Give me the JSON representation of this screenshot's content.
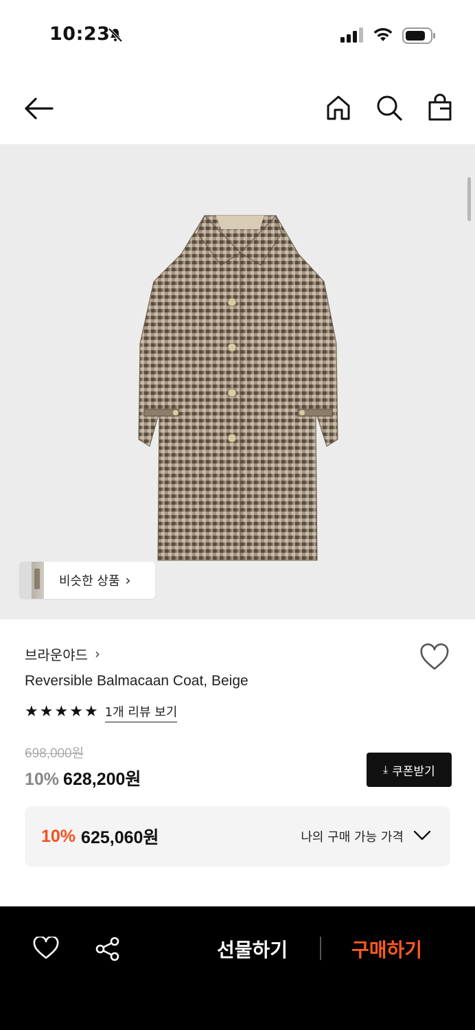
{
  "status": {
    "time": "10:23"
  },
  "nav": {},
  "gallery": {
    "similar_label": "비슷한 상품"
  },
  "product": {
    "brand": "브라운야드",
    "name": "Reversible Balmacaan Coat, Beige",
    "rating_stars": 5,
    "review_link": "1개 리뷰 보기",
    "original_price": "698,000원",
    "discount_pct": "10%",
    "price": "628,200원",
    "coupon_label": "쿠폰받기"
  },
  "my_price": {
    "discount_pct": "10%",
    "price": "625,060원",
    "label": "나의 구매 가능 가격"
  },
  "bottom_bar": {
    "gift_label": "선물하기",
    "buy_label": "구매하기"
  },
  "colors": {
    "accent": "#ff5a1f",
    "background": "#ececec"
  }
}
